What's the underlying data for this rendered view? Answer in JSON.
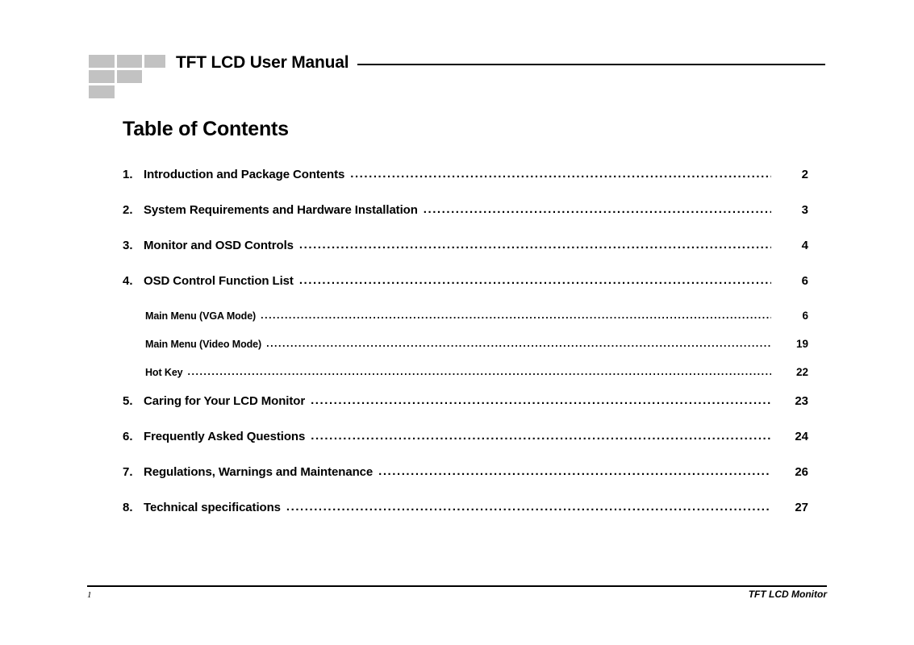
{
  "header": {
    "document_title": "TFT LCD User Manual",
    "logo_color": "#c2c2c2",
    "logo_blocks": [
      "block-1",
      "block-2",
      "block-3",
      "block-4",
      "block-5",
      "block-6"
    ]
  },
  "section": {
    "heading": "Table of Contents"
  },
  "toc": {
    "leader": "..............................................................................................................................................................................................................................................",
    "entries": [
      {
        "number": "1.",
        "label": "Introduction and Package Contents",
        "page": "2",
        "level": 1
      },
      {
        "number": "2.",
        "label": "System Requirements and Hardware Installation",
        "page": "3",
        "level": 1
      },
      {
        "number": "3.",
        "label": "Monitor and OSD Controls",
        "page": "4",
        "level": 1
      },
      {
        "number": "4.",
        "label": "OSD Control Function List",
        "page": "6",
        "level": 1
      },
      {
        "number": "",
        "label": "Main Menu (VGA Mode)",
        "page": "6",
        "level": 2
      },
      {
        "number": "",
        "label": "Main Menu (Video Mode)",
        "page": "19",
        "level": 2
      },
      {
        "number": "",
        "label": "Hot Key",
        "page": "22",
        "level": 2
      },
      {
        "number": "5.",
        "label": "Caring for Your LCD Monitor",
        "page": "23",
        "level": 1
      },
      {
        "number": "6.",
        "label": "Frequently Asked Questions",
        "page": "24",
        "level": 1
      },
      {
        "number": "7.",
        "label": "Regulations, Warnings and Maintenance",
        "page": "26",
        "level": 1
      },
      {
        "number": "8.",
        "label": "Technical specifications",
        "page": "27",
        "level": 1
      }
    ]
  },
  "footer": {
    "page_number": "1",
    "product_name": "TFT LCD Monitor"
  }
}
